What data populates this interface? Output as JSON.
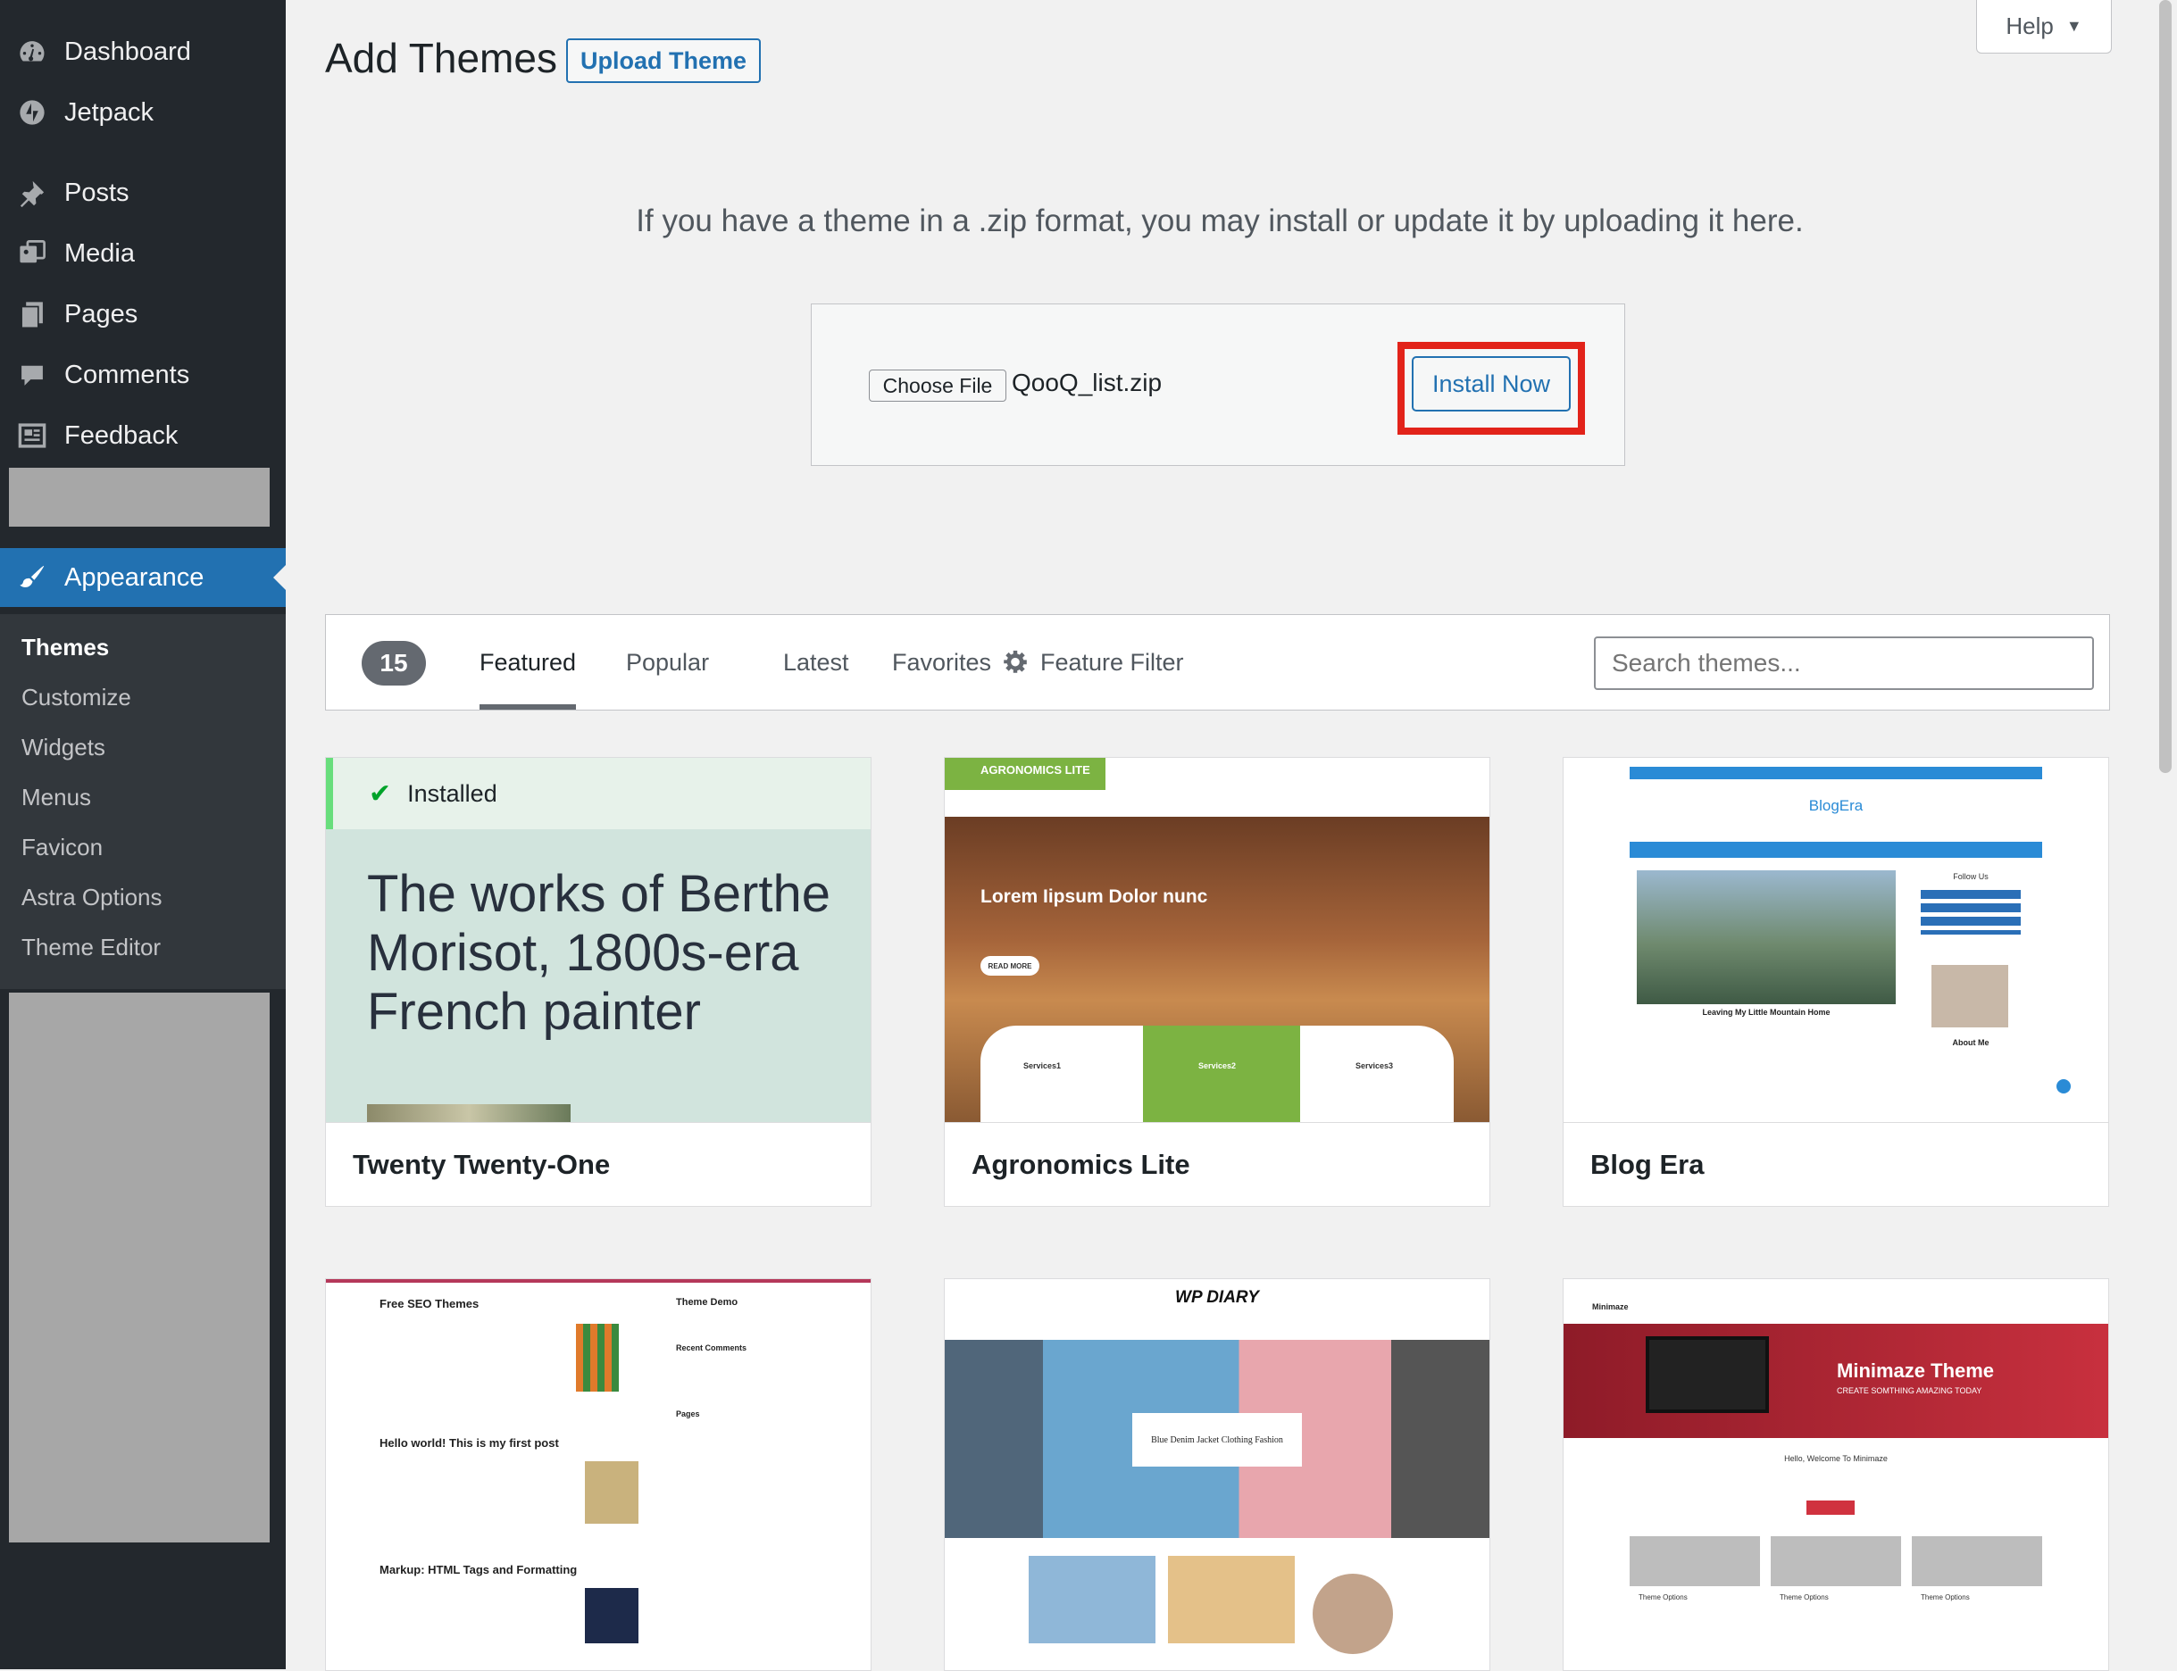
{
  "sidebar": {
    "items": [
      {
        "label": "Dashboard",
        "icon": "dashboard-icon"
      },
      {
        "label": "Jetpack",
        "icon": "jetpack-icon"
      },
      {
        "label": "Posts",
        "icon": "pin-icon"
      },
      {
        "label": "Media",
        "icon": "media-icon"
      },
      {
        "label": "Pages",
        "icon": "pages-icon"
      },
      {
        "label": "Comments",
        "icon": "comment-icon"
      },
      {
        "label": "Feedback",
        "icon": "feedback-icon"
      }
    ],
    "appearance": {
      "label": "Appearance",
      "icon": "paintbrush-icon"
    },
    "submenu": [
      "Themes",
      "Customize",
      "Widgets",
      "Menus",
      "Favicon",
      "Astra Options",
      "Theme Editor"
    ]
  },
  "header": {
    "title": "Add Themes",
    "upload_button": "Upload Theme",
    "help": "Help"
  },
  "upload": {
    "description": "If you have a theme in a .zip format, you may install or update it by uploading it here.",
    "choose_file": "Choose File",
    "file_name": "QooQ_list.zip",
    "install_button": "Install Now"
  },
  "filter": {
    "count": "15",
    "tabs": [
      "Featured",
      "Popular",
      "Latest",
      "Favorites"
    ],
    "feature_filter": "Feature Filter",
    "search_placeholder": "Search themes..."
  },
  "themes": [
    {
      "name": "Twenty Twenty-One",
      "installed": "Installed",
      "tagline": "The works of Berthe Morisot, 1800s-era French painter"
    },
    {
      "name": "Agronomics Lite",
      "brand": "AGRONOMICS LITE",
      "hero": "Lorem Iipsum Dolor nunc",
      "services": [
        "Services1",
        "Services2",
        "Services3"
      ],
      "read_more": "READ MORE"
    },
    {
      "name": "Blog Era",
      "logo": "BlogEra",
      "post": "Leaving My Little Mountain Home",
      "side1": "Follow Us",
      "side2": "About Me"
    },
    {
      "name": "",
      "posts": [
        "Free SEO Themes",
        "Hello world! This is my first post",
        "Markup: HTML Tags and Formatting"
      ],
      "side": [
        "Theme Demo",
        "Recent Comments",
        "Pages"
      ]
    },
    {
      "name": "",
      "logo": "WP DIARY",
      "hero": "Blue Denim Jacket Clothing Fashion"
    },
    {
      "name": "",
      "logo": "Minimaze",
      "hero": "Minimaze Theme",
      "sub": "CREATE SOMTHING AMAZING TODAY",
      "welcome": "Hello, Welcome To Minimaze",
      "options": [
        "Theme Options",
        "Theme Options",
        "Theme Options"
      ]
    }
  ],
  "colors": {
    "sidebar": "#23282d",
    "accent": "#2271b1",
    "highlight": "#e2231a",
    "agro_green": "#7cb342"
  }
}
